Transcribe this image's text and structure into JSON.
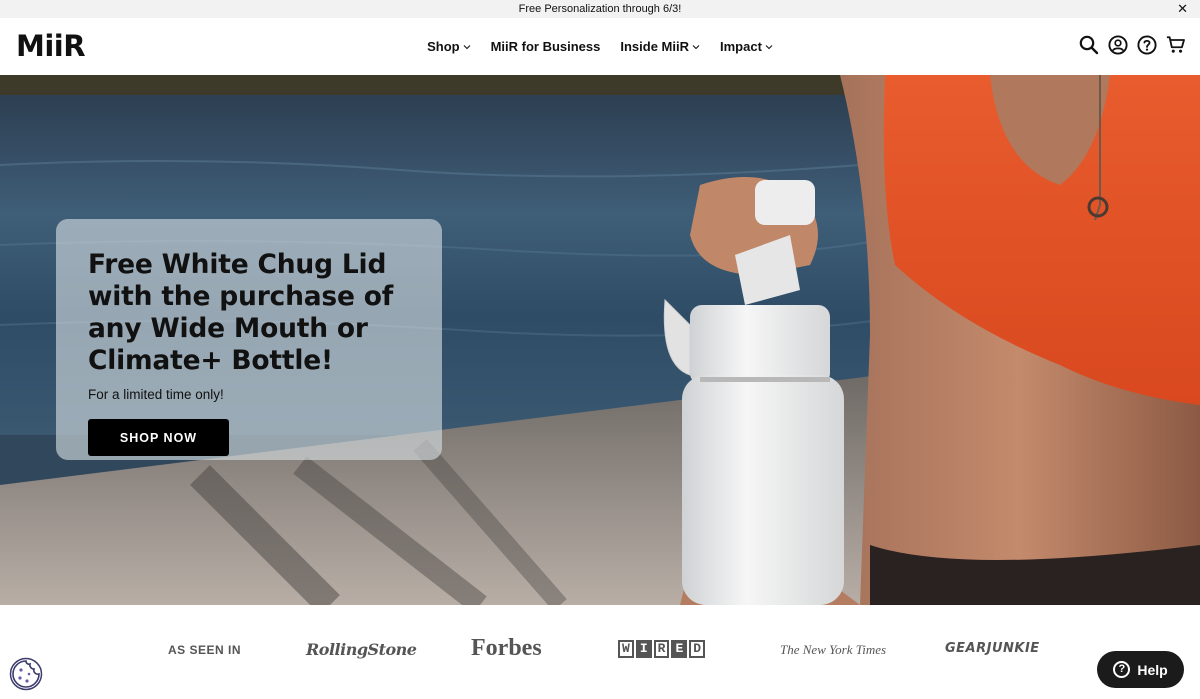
{
  "announcement": {
    "text": "Free Personalization through 6/3!",
    "close_icon": "close-icon"
  },
  "header": {
    "logo": "MiiR",
    "nav": [
      {
        "label": "Shop",
        "has_dropdown": true
      },
      {
        "label": "MiiR for Business",
        "has_dropdown": false
      },
      {
        "label": "Inside MiiR",
        "has_dropdown": true
      },
      {
        "label": "Impact",
        "has_dropdown": true
      }
    ],
    "icons": [
      "search-icon",
      "account-icon",
      "help-circle-icon",
      "cart-icon"
    ]
  },
  "hero": {
    "headline": "Free White Chug Lid with the purchase of any Wide Mouth or Climate+ Bottle!",
    "subtext": "For a limited time only!",
    "cta": "SHOP NOW"
  },
  "press": {
    "label": "AS SEEN IN",
    "logos": {
      "rolling_stone": "RollingStone",
      "forbes": "Forbes",
      "wired": [
        "W",
        "I",
        "R",
        "E",
        "D"
      ],
      "nyt": "The New York Times",
      "gearjunkie": "GEARJUNKIE"
    }
  },
  "widgets": {
    "help": "Help",
    "cookie_icon": "cookie-icon"
  },
  "colors": {
    "announce_bg": "#f2f2f2",
    "cta_bg": "#000000",
    "help_bg": "#1b1b1b",
    "accent_top": "#e65a2e"
  }
}
